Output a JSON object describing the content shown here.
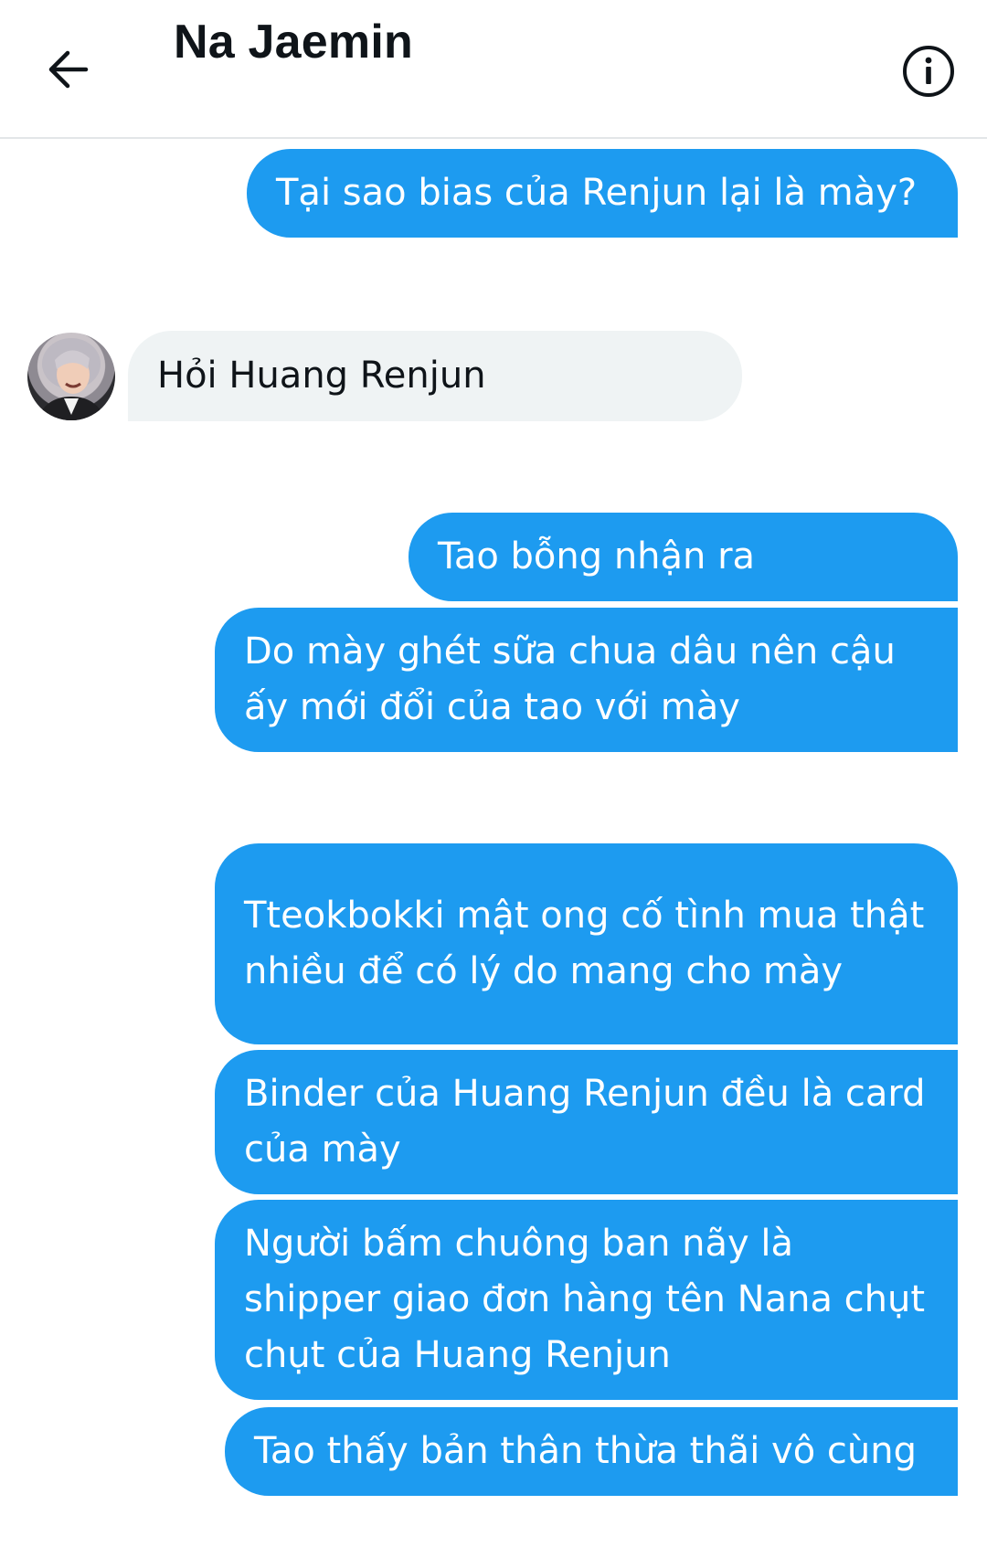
{
  "header": {
    "title": "Na Jaemin"
  },
  "messages": [
    {
      "direction": "out",
      "text": "Tại sao bias của Renjun lại là mày?"
    },
    {
      "direction": "in",
      "text": "Hỏi Huang Renjun"
    },
    {
      "direction": "out",
      "text": "Tao bỗng nhận ra"
    },
    {
      "direction": "out",
      "text": "Do mày ghét sữa chua dâu nên cậu ấy mới đổi của tao với mày"
    },
    {
      "direction": "out",
      "text": "Tteokbokki mật ong cố tình mua thật nhiều để có lý do mang cho mày"
    },
    {
      "direction": "out",
      "text": "Binder của Huang Renjun đều là card của mày"
    },
    {
      "direction": "out",
      "text": "Người bấm chuông ban nãy là shipper giao đơn hàng tên Nana chụt chụt của Huang Renjun"
    },
    {
      "direction": "out",
      "text": "Tao thấy bản thân thừa thãi vô cùng"
    }
  ],
  "icons": {
    "back": "arrow-left-icon",
    "info": "info-circle-icon"
  },
  "colors": {
    "outgoing_bubble": "#1d9bf0",
    "incoming_bubble": "#eff3f4",
    "text_dark": "#0f1419"
  }
}
